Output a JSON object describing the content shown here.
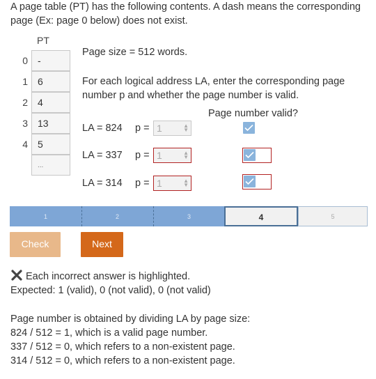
{
  "intro": "A page table (PT) has the following contents. A dash means the corresponding page (Ex: page 0 below) does not exist.",
  "page_table": {
    "header": "PT",
    "rows": [
      {
        "index": "0",
        "value": "-"
      },
      {
        "index": "1",
        "value": "6"
      },
      {
        "index": "2",
        "value": "4"
      },
      {
        "index": "3",
        "value": "13"
      },
      {
        "index": "4",
        "value": "5"
      }
    ],
    "ellipsis": "..."
  },
  "page_size": "Page size = 512 words.",
  "instructions": "For each logical address LA, enter the corresponding page number p and whether the page number is valid.",
  "valid_header": "Page number valid?",
  "questions": [
    {
      "la": "LA = 824",
      "p_label": "p =",
      "p_value": "1",
      "valid_checked": true,
      "incorrect": false
    },
    {
      "la": "LA = 337",
      "p_label": "p =",
      "p_value": "1",
      "valid_checked": true,
      "incorrect": true
    },
    {
      "la": "LA = 314",
      "p_label": "p =",
      "p_value": "1",
      "valid_checked": true,
      "incorrect": true
    }
  ],
  "progress": {
    "steps": [
      "1",
      "2",
      "3",
      "4",
      "5"
    ],
    "current": 4,
    "colors": {
      "done": "#7ea6d6",
      "current_border": "#4a6f96"
    }
  },
  "buttons": {
    "check": "Check",
    "next": "Next"
  },
  "feedback": {
    "icon": "x-mark-icon",
    "message": "Each incorrect answer is highlighted.",
    "expected": "Expected: 1 (valid), 0 (not valid), 0 (not valid)"
  },
  "explanation": {
    "lines": [
      "Page number is obtained by dividing LA by page size:",
      "824 / 512 = 1, which is a valid page number.",
      "337 / 512 = 0, which refers to a non-existent page.",
      "314 / 512 = 0, which refers to a non-existent page."
    ]
  },
  "colors": {
    "accent": "#d4681a",
    "error": "#b22222",
    "checkbox": "#8ab4dc"
  }
}
